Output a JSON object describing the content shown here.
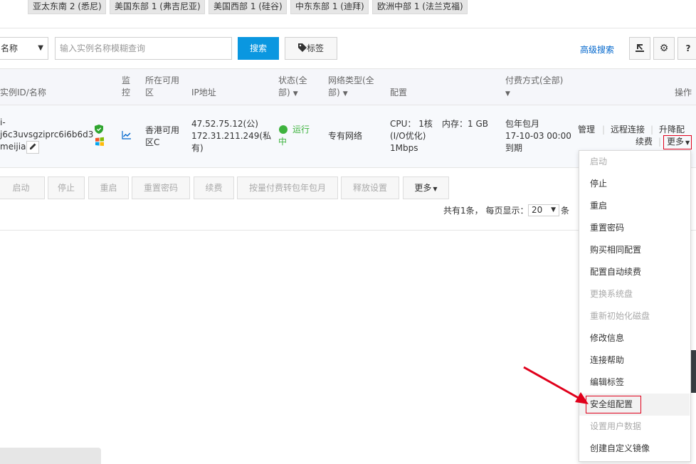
{
  "regions": [
    "亚太东南 2 (悉尼)",
    "美国东部 1 (弗吉尼亚)",
    "美国西部 1 (硅谷)",
    "中东东部 1 (迪拜)",
    "欧洲中部 1 (法兰克福)"
  ],
  "search": {
    "filter_value": "名称",
    "placeholder": "输入实例名称模糊查询",
    "search_label": "搜索",
    "tag_label": "标签",
    "advanced_label": "高级搜索",
    "help_label": "?"
  },
  "table": {
    "headers": {
      "id_name": "实例ID/名称",
      "monitor_1": "监",
      "monitor_2": "控",
      "zone_1": "所在可用",
      "zone_2": "区",
      "ip": "IP地址",
      "status_1": "状态(全",
      "status_2": "部)",
      "network_1": "网络类型(全",
      "network_2": "部)",
      "config": "配置",
      "billing_1": "付费方式(全部)",
      "ops": "操作"
    },
    "row": {
      "id_line1": "i-",
      "id_line2": "j6c3uvsgziprc6i6b6d3",
      "name": "meijia",
      "zone_1": "香港可用",
      "zone_2": "区C",
      "ip_public": "47.52.75.12(公)",
      "ip_private_1": "172.31.211.249(私",
      "ip_private_2": "有)",
      "status_1": "运行",
      "status_2": "中",
      "network": "专有网络",
      "cpu": "CPU： 1核",
      "memory": "内存：1 GB",
      "io": "(I/O优化)",
      "bandwidth": "1Mbps",
      "billing_1": "包年包月",
      "billing_2": "17-10-03 00:00",
      "billing_3": "到期",
      "op_manage": "管理",
      "op_remote": "远程连接",
      "op_resize": "升降配",
      "op_renew": "续费",
      "op_more": "更多"
    }
  },
  "bulk_actions": {
    "start": "启动",
    "stop": "停止",
    "restart": "重启",
    "reset_pwd": "重置密码",
    "renew": "续费",
    "convert": "按量付费转包年包月",
    "release": "释放设置",
    "more": "更多"
  },
  "pagination": {
    "total_text": "共有1条， 每页显示：",
    "page_size": "20",
    "unit": "条"
  },
  "more_menu": [
    {
      "label": "启动",
      "disabled": true
    },
    {
      "label": "停止",
      "disabled": false
    },
    {
      "label": "重启",
      "disabled": false
    },
    {
      "label": "重置密码",
      "disabled": false
    },
    {
      "label": "购买相同配置",
      "disabled": false
    },
    {
      "label": "配置自动续费",
      "disabled": false
    },
    {
      "label": "更换系统盘",
      "disabled": true
    },
    {
      "label": "重新初始化磁盘",
      "disabled": true
    },
    {
      "label": "修改信息",
      "disabled": false
    },
    {
      "label": "连接帮助",
      "disabled": false
    },
    {
      "label": "编辑标签",
      "disabled": false
    },
    {
      "label": "安全组配置",
      "disabled": false
    },
    {
      "label": "设置用户数据",
      "disabled": true
    },
    {
      "label": "创建自定义镜像",
      "disabled": false
    }
  ],
  "colors": {
    "primary": "#0a97e0",
    "link": "#0066cc",
    "running": "#3eb33e",
    "highlight_red": "#e0001b"
  }
}
